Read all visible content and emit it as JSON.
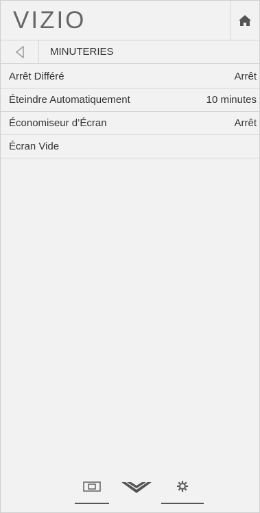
{
  "header": {
    "logo": "VIZIO",
    "home_icon": "home-icon"
  },
  "subheader": {
    "back_icon": "back-arrow-icon",
    "title": "MINUTERIES"
  },
  "menu": {
    "items": [
      {
        "label": "Arrêt Différé",
        "value": "Arrêt"
      },
      {
        "label": "Éteindre Automatiquement",
        "value": "10 minutes"
      },
      {
        "label": "Économiseur d’Écran",
        "value": "Arrêt"
      },
      {
        "label": "Écran Vide",
        "value": ""
      }
    ]
  },
  "bottom_nav": {
    "items": [
      "input-icon",
      "vizio-v-icon",
      "settings-gear-icon"
    ]
  },
  "colors": {
    "background": "#f2f2f2",
    "divider": "#d4d4d4",
    "text": "#333333",
    "logo": "#666666"
  }
}
